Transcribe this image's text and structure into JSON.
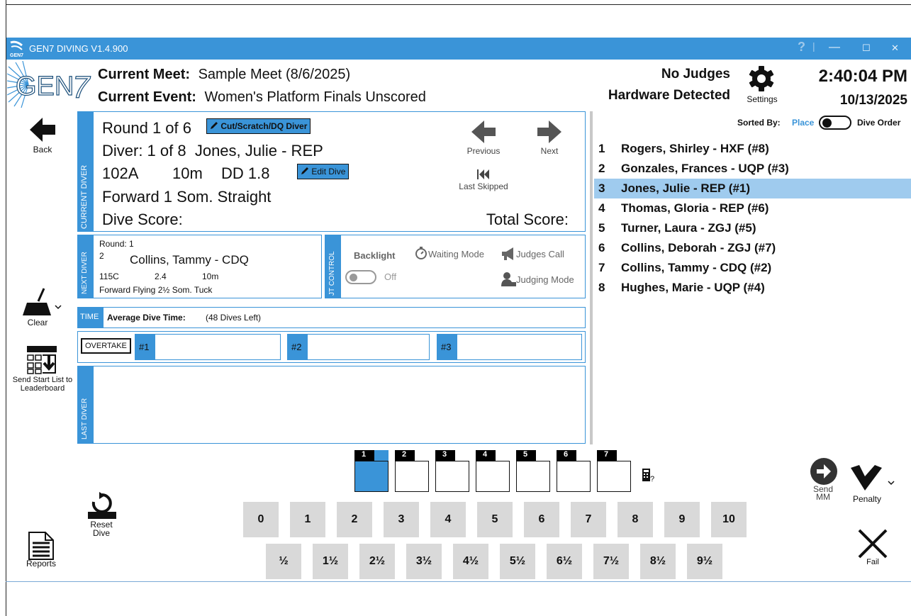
{
  "window": {
    "title": "GEN7 DIVING V1.4.900",
    "help": "?",
    "minimize": "—",
    "maximize": "☐",
    "close": "✕"
  },
  "header": {
    "meet_label": "Current Meet:",
    "meet_value": "Sample Meet (8/6/2025)",
    "event_label": "Current Event:",
    "event_value": "Women's Platform Finals Unscored",
    "judges_line1": "No Judges",
    "judges_line2": "Hardware Detected",
    "settings": "Settings",
    "time": "2:40:04 PM",
    "date": "10/13/2025"
  },
  "left": {
    "back": "Back",
    "clear": "Clear",
    "send_start": "Send Start List to Leaderboard",
    "reset": "Reset Dive",
    "reports": "Reports"
  },
  "current": {
    "tab": "CURRENT DIVER",
    "round": "Round 1 of 6",
    "cut_btn": "Cut/Scratch/DQ Diver",
    "diver": "Diver: 1 of 8  Jones, Julie - REP",
    "dive_no": "102A",
    "height": "10m",
    "dd": "DD 1.8",
    "edit_btn": "Edit Dive",
    "dive_name": "Forward 1 Som. Straight",
    "dive_score": "Dive Score:",
    "total_score": "Total Score:",
    "previous": "Previous",
    "next": "Next",
    "last_skipped": "Last Skipped"
  },
  "next_diver": {
    "tab": "NEXT DIVER",
    "round": "Round:  1",
    "order": "2",
    "name": "Collins, Tammy - CDQ",
    "dive_no": "115C",
    "dd": "2.4",
    "height": "10m",
    "dive_name": "Forward Flying 2½ Som. Tuck"
  },
  "jt": {
    "tab": "JT CONTROL",
    "backlight": "Backlight",
    "off": "Off",
    "waiting": "Waiting Mode",
    "judges_call": "Judges Call",
    "judging": "Judging Mode"
  },
  "time": {
    "tab": "TIME",
    "label": "Average Dive Time:",
    "left": "(48 Dives Left)"
  },
  "overtake": {
    "button": "OVERTAKE",
    "slots": [
      "#1",
      "#2",
      "#3"
    ]
  },
  "last_diver": {
    "tab": "LAST DIVER"
  },
  "leaderboard": {
    "sorted_by": "Sorted By:",
    "place": "Place",
    "dive_order": "Dive Order",
    "rows": [
      {
        "rank": "1",
        "name": "Rogers, Shirley - HXF (#8)"
      },
      {
        "rank": "2",
        "name": "Gonzales, Frances - UQP (#3)"
      },
      {
        "rank": "3",
        "name": "Jones, Julie - REP (#1)"
      },
      {
        "rank": "4",
        "name": "Thomas, Gloria - REP (#6)"
      },
      {
        "rank": "5",
        "name": "Turner, Laura - ZGJ (#5)"
      },
      {
        "rank": "6",
        "name": "Collins, Deborah - ZGJ (#7)"
      },
      {
        "rank": "7",
        "name": "Collins, Tammy - CDQ (#2)"
      },
      {
        "rank": "8",
        "name": "Hughes, Marie - UQP (#4)"
      }
    ],
    "selected_index": 2
  },
  "judges": [
    "1",
    "2",
    "3",
    "4",
    "5",
    "6",
    "7"
  ],
  "scores_whole": [
    "0",
    "1",
    "2",
    "3",
    "4",
    "5",
    "6",
    "7",
    "8",
    "9",
    "10"
  ],
  "scores_half": [
    "½",
    "1½",
    "2½",
    "3½",
    "4½",
    "5½",
    "6½",
    "7½",
    "8½",
    "9½"
  ],
  "right_actions": {
    "send_mm": "Send MM",
    "penalty": "Penalty",
    "fail": "Fail"
  },
  "colors": {
    "accent": "#3a94d8",
    "selected_row": "#9fcbee",
    "score_button": "#d9d9d9"
  }
}
